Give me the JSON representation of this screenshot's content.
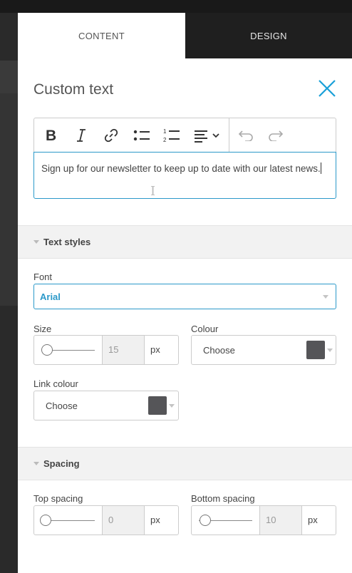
{
  "tabs": {
    "content": "CONTENT",
    "design": "DESIGN"
  },
  "panel": {
    "title": "Custom text"
  },
  "editor": {
    "text": "Sign up for our newsletter to keep up to date with our latest news."
  },
  "toolbar": {
    "icons": [
      "bold-icon",
      "italic-icon",
      "link-icon",
      "bullet-list-icon",
      "numbered-list-icon",
      "align-icon",
      "undo-icon",
      "redo-icon"
    ]
  },
  "text_styles": {
    "heading": "Text styles",
    "font_label": "Font",
    "font_value": "Arial",
    "size_label": "Size",
    "size_value": "15",
    "size_unit": "px",
    "colour_label": "Colour",
    "colour_choose": "Choose",
    "colour_swatch": "#555558",
    "link_colour_label": "Link colour",
    "link_colour_choose": "Choose",
    "link_colour_swatch": "#555558"
  },
  "spacing": {
    "heading": "Spacing",
    "top_label": "Top spacing",
    "top_value": "0",
    "top_unit": "px",
    "bottom_label": "Bottom spacing",
    "bottom_value": "10",
    "bottom_unit": "px"
  },
  "colors": {
    "accent": "#2b99c9",
    "close": "#1aa0d8"
  }
}
